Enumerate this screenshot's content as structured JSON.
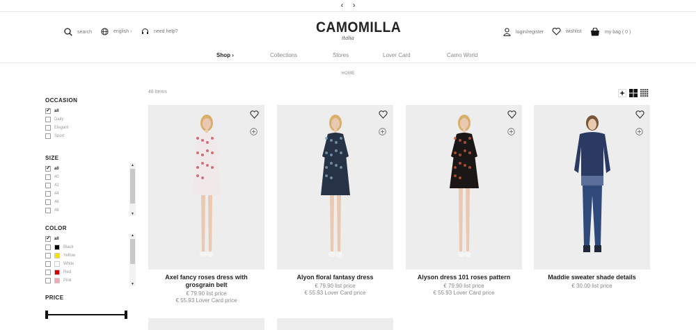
{
  "topbar": {
    "prev": "‹",
    "next": "›"
  },
  "header": {
    "search": "search",
    "language": "english ›",
    "help": "need help?",
    "logo": "CAMOMILLA",
    "logo_sub": "italia",
    "login": "login/register",
    "wishlist": "wishlist",
    "bag": "my bag ( 0 )"
  },
  "nav": {
    "items": [
      "Shop ›",
      "Collections",
      "Stores",
      "Lover Card",
      "Camo World"
    ]
  },
  "breadcrumb": "HOME",
  "listing": {
    "count": "48 Items"
  },
  "filters": {
    "occasion": {
      "title": "OCCASION",
      "options": [
        "all",
        "Daily",
        "Elegant",
        "Sport"
      ]
    },
    "size": {
      "title": "SIZE",
      "options": [
        "all",
        "40",
        "42",
        "44",
        "46",
        "48"
      ]
    },
    "color": {
      "title": "COLOR",
      "options": [
        "all",
        "Black",
        "Yellow",
        "White",
        "Red",
        "Pink"
      ],
      "swatches": [
        "#000000",
        "#f5e400",
        "#ffffff",
        "#d40000",
        "#f4a5b6"
      ]
    },
    "price": {
      "title": "PRICE"
    }
  },
  "products": [
    {
      "name": "Axel fancy roses dress with grosgrain belt",
      "price": "€ 79.90 list price",
      "lover": "€ 55.93 Lover Card price",
      "dress_color": "#f1e9e9",
      "pattern": "#c9505d"
    },
    {
      "name": "Alyon floral fantasy dress",
      "price": "€ 79.90 list price",
      "lover": "€ 55.93 Lover Card price",
      "dress_color": "#263245",
      "pattern": "#7fa0b5"
    },
    {
      "name": "Alyson dress 101 roses pattern",
      "price": "€ 79.90 list price",
      "lover": "€ 55.93 Lover Card price",
      "dress_color": "#1c1717",
      "pattern": "#c55a3a"
    },
    {
      "name": "Maddie sweater shade details",
      "price": "€ 30.00 list price",
      "lover": "",
      "dress_color": "#2a3a63",
      "pattern": "#5c6f9a"
    }
  ]
}
